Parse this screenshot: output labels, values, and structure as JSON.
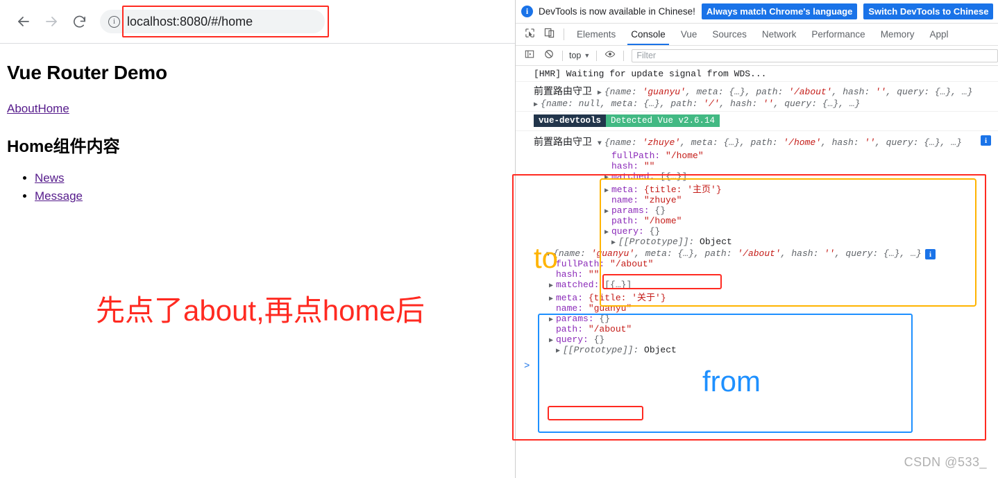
{
  "browser": {
    "back_icon": "arrow-left-icon",
    "forward_icon": "arrow-right-icon",
    "reload_icon": "reload-icon",
    "site_info_icon": "info-circle-icon",
    "url": "localhost:8080/#/home",
    "url_host": "localhost:8080",
    "url_path": "/#/home"
  },
  "page": {
    "title": "Vue Router Demo",
    "nav_links": [
      {
        "label": "About"
      },
      {
        "label": "Home"
      }
    ],
    "subtitle": "Home组件内容",
    "list_items": [
      {
        "label": "News"
      },
      {
        "label": "Message"
      }
    ],
    "annotation": "先点了about,再点home后"
  },
  "devtools": {
    "banner": {
      "info_icon": "info-icon",
      "message": "DevTools is now available in Chinese!",
      "button_primary": "Always match Chrome's language",
      "button_secondary": "Switch DevTools to Chinese"
    },
    "toolbar_icons": [
      {
        "name": "inspect-element-icon"
      },
      {
        "name": "device-toolbar-icon"
      }
    ],
    "tabs": [
      {
        "label": "Elements",
        "active": false
      },
      {
        "label": "Console",
        "active": true
      },
      {
        "label": "Vue",
        "active": false
      },
      {
        "label": "Sources",
        "active": false
      },
      {
        "label": "Network",
        "active": false
      },
      {
        "label": "Performance",
        "active": false
      },
      {
        "label": "Memory",
        "active": false
      },
      {
        "label": "Appl",
        "active": false
      }
    ],
    "console_bar": {
      "sidebar_icon": "console-sidebar-icon",
      "clear_icon": "clear-console-icon",
      "context": "top",
      "caret": "▼",
      "eye_icon": "live-expression-eye-icon",
      "filter_placeholder": "Filter"
    },
    "console": {
      "line_hmr": "[HMR] Waiting for update signal from WDS...",
      "guard_label": "前置路由守卫",
      "collapsed_to_about": {
        "name_key": "name:",
        "name_val": "'guanyu'",
        "meta_key": "meta:",
        "meta_val": "{…}",
        "path_key": "path:",
        "path_val": "'/about'",
        "hash_key": "hash:",
        "hash_val": "''",
        "query_key": "query:",
        "query_val": "{…}",
        "ellipsis": "…"
      },
      "collapsed_from_root": {
        "name_key": "name:",
        "name_val": "null",
        "meta_key": "meta:",
        "meta_val": "{…}",
        "path_key": "path:",
        "path_val": "'/'",
        "hash_key": "hash:",
        "hash_val": "''",
        "query_key": "query:",
        "query_val": "{…}",
        "ellipsis": "…"
      },
      "vue_badge": {
        "source": "vue-devtools",
        "message": "Detected Vue v2.6.14"
      },
      "to_object": {
        "header": {
          "name_key": "name:",
          "name_val": "'zhuye'",
          "meta_key": "meta:",
          "meta_val": "{…}",
          "path_key": "path:",
          "path_val": "'/home'",
          "hash_key": "hash:",
          "hash_val": "''",
          "query_key": "query:",
          "query_val": "{…}",
          "ellipsis": "…"
        },
        "props": [
          {
            "key": "fullPath:",
            "value": "\"/home\"",
            "expandable": false,
            "highlight": false
          },
          {
            "key": "hash:",
            "value": "\"\"",
            "expandable": false,
            "highlight": false
          },
          {
            "key": "matched:",
            "value": "[{…}]",
            "expandable": true,
            "highlight": false
          },
          {
            "key": "meta:",
            "value": "{title: '主页'}",
            "expandable": true,
            "highlight": false
          },
          {
            "key": "name:",
            "value": "\"zhuye\"",
            "expandable": false,
            "highlight": false
          },
          {
            "key": "params:",
            "value": "{}",
            "expandable": true,
            "highlight": false
          },
          {
            "key": "path:",
            "value": "\"/home\"",
            "expandable": false,
            "highlight": true
          },
          {
            "key": "query:",
            "value": "{}",
            "expandable": true,
            "highlight": false
          },
          {
            "key": "[[Prototype]]:",
            "value": "Object",
            "expandable": true,
            "highlight": false
          }
        ]
      },
      "from_object": {
        "header": {
          "name_key": "name:",
          "name_val": "'guanyu'",
          "meta_key": "meta:",
          "meta_val": "{…}",
          "path_key": "path:",
          "path_val": "'/about'",
          "hash_key": "hash:",
          "hash_val": "''",
          "query_key": "query:",
          "query_val": "{…}",
          "ellipsis": "…"
        },
        "props": [
          {
            "key": "fullPath:",
            "value": "\"/about\"",
            "expandable": false,
            "highlight": false
          },
          {
            "key": "hash:",
            "value": "\"\"",
            "expandable": false,
            "highlight": false
          },
          {
            "key": "matched:",
            "value": "[{…}]",
            "expandable": true,
            "highlight": false
          },
          {
            "key": "meta:",
            "value": "{title: '关于'}",
            "expandable": true,
            "highlight": false
          },
          {
            "key": "name:",
            "value": "\"guanyu\"",
            "expandable": false,
            "highlight": false
          },
          {
            "key": "params:",
            "value": "{}",
            "expandable": true,
            "highlight": false
          },
          {
            "key": "path:",
            "value": "\"/about\"",
            "expandable": false,
            "highlight": true
          },
          {
            "key": "query:",
            "value": "{}",
            "expandable": true,
            "highlight": false
          },
          {
            "key": "[[Prototype]]:",
            "value": "Object",
            "expandable": true,
            "highlight": false
          }
        ]
      },
      "prompt": ">",
      "watermark": "CSDN @533_"
    },
    "annotations": {
      "to_label": "to",
      "from_label": "from",
      "to_color": "#ffb400",
      "from_color": "#1e90ff",
      "highlight_color": "#ff2a21"
    }
  }
}
